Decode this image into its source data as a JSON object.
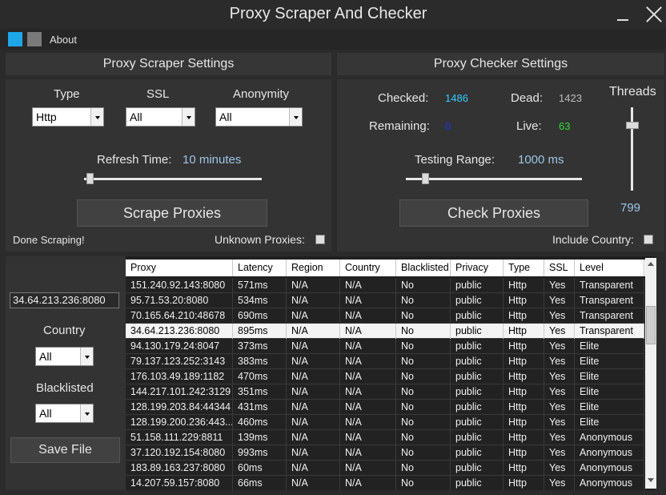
{
  "window": {
    "title": "Proxy Scraper And Checker"
  },
  "menu": {
    "about": "About"
  },
  "colors": {
    "accent_blue": "#1ea7e8",
    "checked": "#33ccff",
    "remaining": "#2233ff",
    "live": "#33dd33"
  },
  "scraper": {
    "title": "Proxy Scraper Settings",
    "type_label": "Type",
    "type_value": "Http",
    "ssl_label": "SSL",
    "ssl_value": "All",
    "anon_label": "Anonymity",
    "anon_value": "All",
    "refresh_label": "Refresh Time:",
    "refresh_value": "10 minutes",
    "scrape_button": "Scrape Proxies",
    "status": "Done Scraping!",
    "unknown_label": "Unknown Proxies:"
  },
  "checker": {
    "title": "Proxy Checker Settings",
    "checked_label": "Checked:",
    "checked_value": "1486",
    "dead_label": "Dead:",
    "dead_value": "1423",
    "remaining_label": "Remaining:",
    "remaining_value": "0",
    "live_label": "Live:",
    "live_value": "63",
    "threads_label": "Threads",
    "threads_value": "799",
    "range_label": "Testing Range:",
    "range_value": "1000 ms",
    "check_button": "Check Proxies",
    "country_label": "Include Country:"
  },
  "filters": {
    "selected_proxy": "34.64.213.236:8080",
    "country_label": "Country",
    "country_value": "All",
    "blacklisted_label": "Blacklisted",
    "blacklisted_value": "All",
    "save_button": "Save File"
  },
  "table": {
    "columns": [
      "Proxy",
      "Latency",
      "Region",
      "Country",
      "Blacklisted",
      "Privacy",
      "Type",
      "SSL",
      "Level"
    ],
    "rows": [
      [
        "151.240.92.143:8080",
        "571ms",
        "N/A",
        "N/A",
        "No",
        "public",
        "Http",
        "Yes",
        "Transparent"
      ],
      [
        "95.71.53.20:8080",
        "534ms",
        "N/A",
        "N/A",
        "No",
        "public",
        "Http",
        "Yes",
        "Transparent"
      ],
      [
        "70.165.64.210:48678",
        "690ms",
        "N/A",
        "N/A",
        "No",
        "public",
        "Http",
        "Yes",
        "Transparent"
      ],
      [
        "34.64.213.236:8080",
        "895ms",
        "N/A",
        "N/A",
        "No",
        "public",
        "Http",
        "Yes",
        "Transparent"
      ],
      [
        "94.130.179.24:8047",
        "373ms",
        "N/A",
        "N/A",
        "No",
        "public",
        "Http",
        "Yes",
        "Elite"
      ],
      [
        "79.137.123.252:3143",
        "383ms",
        "N/A",
        "N/A",
        "No",
        "public",
        "Http",
        "Yes",
        "Elite"
      ],
      [
        "176.103.49.189:1182",
        "470ms",
        "N/A",
        "N/A",
        "No",
        "public",
        "Http",
        "Yes",
        "Elite"
      ],
      [
        "144.217.101.242:3129",
        "351ms",
        "N/A",
        "N/A",
        "No",
        "public",
        "Http",
        "Yes",
        "Elite"
      ],
      [
        "128.199.203.84:44344",
        "431ms",
        "N/A",
        "N/A",
        "No",
        "public",
        "Http",
        "Yes",
        "Elite"
      ],
      [
        "128.199.200.236:443...",
        "460ms",
        "N/A",
        "N/A",
        "No",
        "public",
        "Http",
        "Yes",
        "Elite"
      ],
      [
        "51.158.111.229:8811",
        "139ms",
        "N/A",
        "N/A",
        "No",
        "public",
        "Http",
        "Yes",
        "Anonymous"
      ],
      [
        "37.120.192.154:8080",
        "993ms",
        "N/A",
        "N/A",
        "No",
        "public",
        "Http",
        "Yes",
        "Anonymous"
      ],
      [
        "183.89.163.237:8080",
        "60ms",
        "N/A",
        "N/A",
        "No",
        "public",
        "Http",
        "Yes",
        "Anonymous"
      ],
      [
        "14.207.59.157:8080",
        "66ms",
        "N/A",
        "N/A",
        "No",
        "public",
        "Http",
        "Yes",
        "Anonymous"
      ]
    ]
  }
}
